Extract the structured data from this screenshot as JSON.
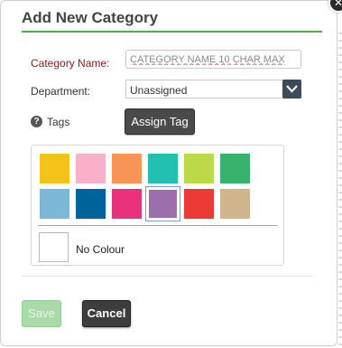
{
  "dialog": {
    "title": "Add New Category",
    "close_icon": "close-icon",
    "close_glyph": "✕"
  },
  "form": {
    "category_name_label": "Category Name:",
    "category_name_placeholder": "CATEGORY NAME 10 CHAR MAX",
    "category_name_value": "",
    "department_label": "Department:",
    "department_selected": "Unassigned",
    "tags_label": "Tags",
    "help_icon": "help-icon",
    "help_glyph": "?",
    "assign_tag_label": "Assign Tag"
  },
  "palette": {
    "swatches": [
      {
        "color": "#f2c318"
      },
      {
        "color": "#fbb0ca"
      },
      {
        "color": "#f89455"
      },
      {
        "color": "#22c0b0"
      },
      {
        "color": "#bcd94a"
      },
      {
        "color": "#39b26d"
      },
      {
        "color": "#7bb8d6"
      },
      {
        "color": "#00649b"
      },
      {
        "color": "#e8327c"
      },
      {
        "color": "#9b6fae",
        "selected": true
      },
      {
        "color": "#ee3a35"
      },
      {
        "color": "#d0b48c"
      }
    ],
    "no_colour_label": "No Colour"
  },
  "footer": {
    "save_label": "Save",
    "cancel_label": "Cancel"
  },
  "colors": {
    "accent_green": "#4cae4c",
    "save_disabled": "#a9dba9",
    "dark_button": "#3d3d3d"
  }
}
